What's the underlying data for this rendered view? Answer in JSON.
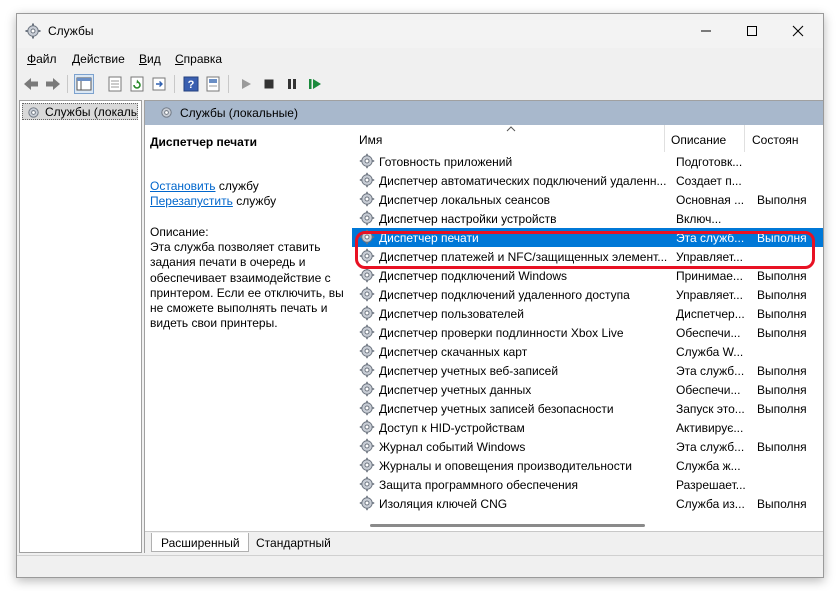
{
  "window": {
    "title": "Службы"
  },
  "menu": [
    "Файл",
    "Действие",
    "Вид",
    "Справка"
  ],
  "menu_accels": [
    "Ф",
    "Д",
    "В",
    "С"
  ],
  "menu_rest": [
    "айл",
    "ействие",
    "ид",
    "правка"
  ],
  "tree": {
    "item_label": "Службы (локальны"
  },
  "main": {
    "header_title": "Службы (локальные)",
    "selected_service": "Диспетчер печати",
    "stop_link": "Остановить",
    "stop_suffix": " службу",
    "restart_link": "Перезапустить",
    "restart_suffix": " службу",
    "description_label": "Описание:",
    "description_text": "Эта служба позволяет ставить задания печати в очередь и обеспечивает взаимодействие с принтером.  Если ее отключить, вы не сможете выполнять печать и видеть свои принтеры."
  },
  "columns": {
    "name": "Имя",
    "description": "Описание",
    "status": "Состоян"
  },
  "services": [
    {
      "name": "Готовность приложений",
      "desc": "Подготовк...",
      "status": ""
    },
    {
      "name": "Диспетчер автоматических подключений удаленн...",
      "desc": "Создает п...",
      "status": ""
    },
    {
      "name": "Диспетчер локальных сеансов",
      "desc": "Основная ...",
      "status": "Выполня"
    },
    {
      "name": "Диспетчер настройки устройств",
      "desc": "Включ...",
      "status": ""
    },
    {
      "name": "Диспетчер печати",
      "desc": "Эта служб...",
      "status": "Выполня"
    },
    {
      "name": "Диспетчер платежей и NFC/защищенных элемент...",
      "desc": "Управляет...",
      "status": ""
    },
    {
      "name": "Диспетчер подключений Windows",
      "desc": "Принимае...",
      "status": "Выполня"
    },
    {
      "name": "Диспетчер подключений удаленного доступа",
      "desc": "Управляет...",
      "status": "Выполня"
    },
    {
      "name": "Диспетчер пользователей",
      "desc": "Диспетчер...",
      "status": "Выполня"
    },
    {
      "name": "Диспетчер проверки подлинности Xbox Live",
      "desc": "Обеспечи...",
      "status": "Выполня"
    },
    {
      "name": "Диспетчер скачанных карт",
      "desc": "Служба W...",
      "status": ""
    },
    {
      "name": "Диспетчер учетных веб-записей",
      "desc": "Эта служб...",
      "status": "Выполня"
    },
    {
      "name": "Диспетчер учетных данных",
      "desc": "Обеспечи...",
      "status": "Выполня"
    },
    {
      "name": "Диспетчер учетных записей безопасности",
      "desc": "Запуск это...",
      "status": "Выполня"
    },
    {
      "name": "Доступ к HID-устройствам",
      "desc": "Активирує...",
      "status": ""
    },
    {
      "name": "Журнал событий Windows",
      "desc": "Эта служб...",
      "status": "Выполня"
    },
    {
      "name": "Журналы и оповещения производительности",
      "desc": "Служба ж...",
      "status": ""
    },
    {
      "name": "Защита программного обеспечения",
      "desc": "Разрешает...",
      "status": ""
    },
    {
      "name": "Изоляция ключей CNG",
      "desc": "Служба из...",
      "status": "Выполня"
    }
  ],
  "tabs": {
    "extended": "Расширенный",
    "standard": "Стандартный"
  },
  "colors": {
    "selection": "#0078d7",
    "highlight_box": "#e81123",
    "header_bar": "#a8b8cc",
    "link": "#0066cc"
  }
}
